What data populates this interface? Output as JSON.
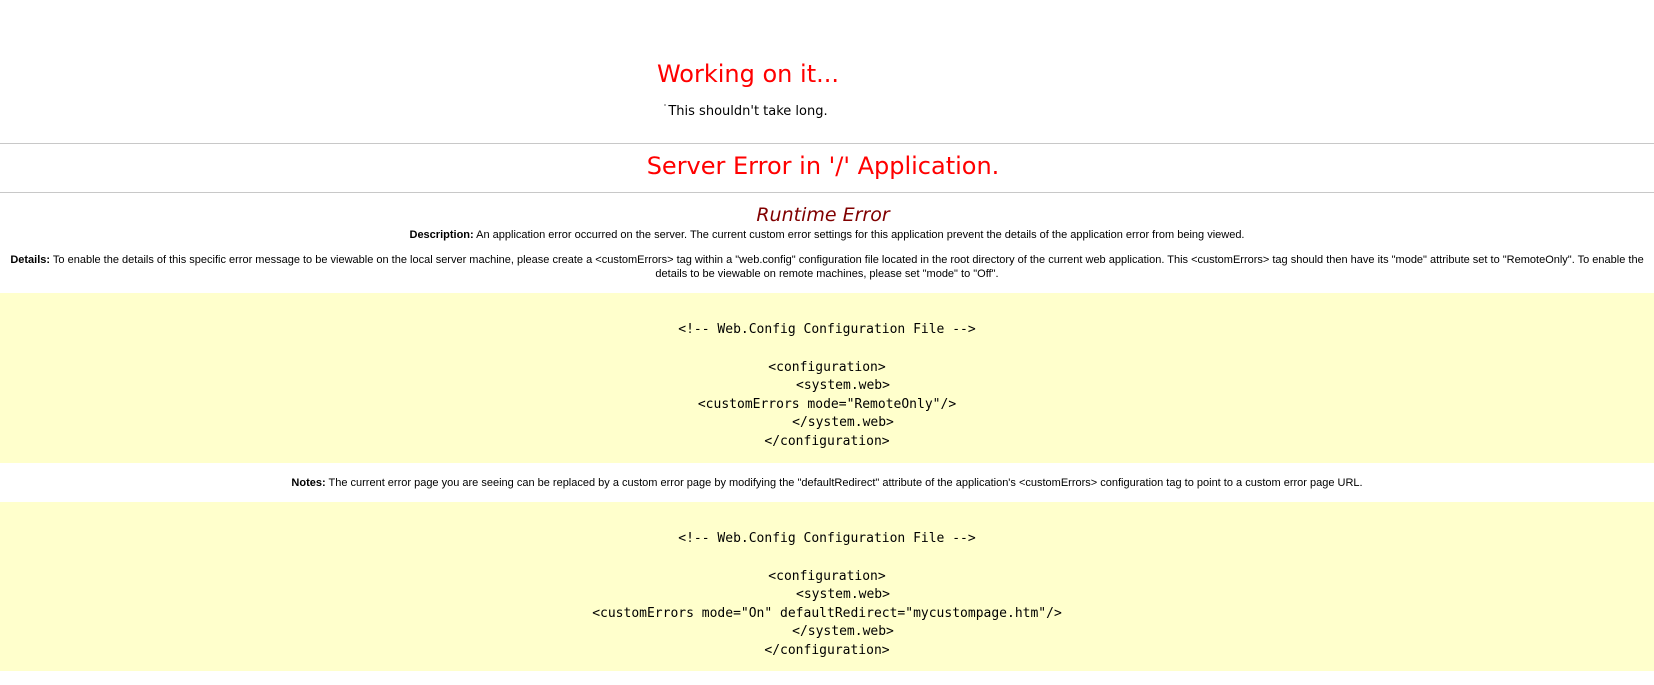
{
  "working": {
    "title": "Working on it...",
    "subtitle": "This shouldn't take long."
  },
  "error": {
    "server_error_title": "Server Error in '/' Application.",
    "runtime_title": "Runtime Error",
    "description_label": "Description:",
    "description_text": " An application error occurred on the server. The current custom error settings for this application prevent the details of the application error from being viewed.",
    "details_label": "Details:",
    "details_text": " To enable the details of this specific error message to be viewable on the local server machine, please create a <customErrors> tag within a \"web.config\" configuration file located in the root directory of the current web application. This <customErrors> tag should then have its \"mode\" attribute set to \"RemoteOnly\". To enable the details to be viewable on remote machines, please set \"mode\" to \"Off\".",
    "notes_label": "Notes:",
    "notes_text": " The current error page you are seeing can be replaced by a custom error page by modifying the \"defaultRedirect\" attribute of the application's <customErrors> configuration tag to point to a custom error page URL."
  },
  "code_blocks": {
    "first": {
      "line1": "<!-- Web.Config Configuration File -->",
      "line2": "<configuration>",
      "line3": "<system.web>",
      "line4": "<customErrors mode=\"RemoteOnly\"/>",
      "line5": "</system.web>",
      "line6": "</configuration>"
    },
    "second": {
      "line1": "<!-- Web.Config Configuration File -->",
      "line2": "<configuration>",
      "line3": "<system.web>",
      "line4": "<customErrors mode=\"On\" defaultRedirect=\"mycustompage.htm\"/>",
      "line5": "</system.web>",
      "line6": "</configuration>"
    }
  },
  "colors": {
    "error_red": "#ff0000",
    "runtime_maroon": "#800000",
    "code_background": "#ffffcc"
  }
}
